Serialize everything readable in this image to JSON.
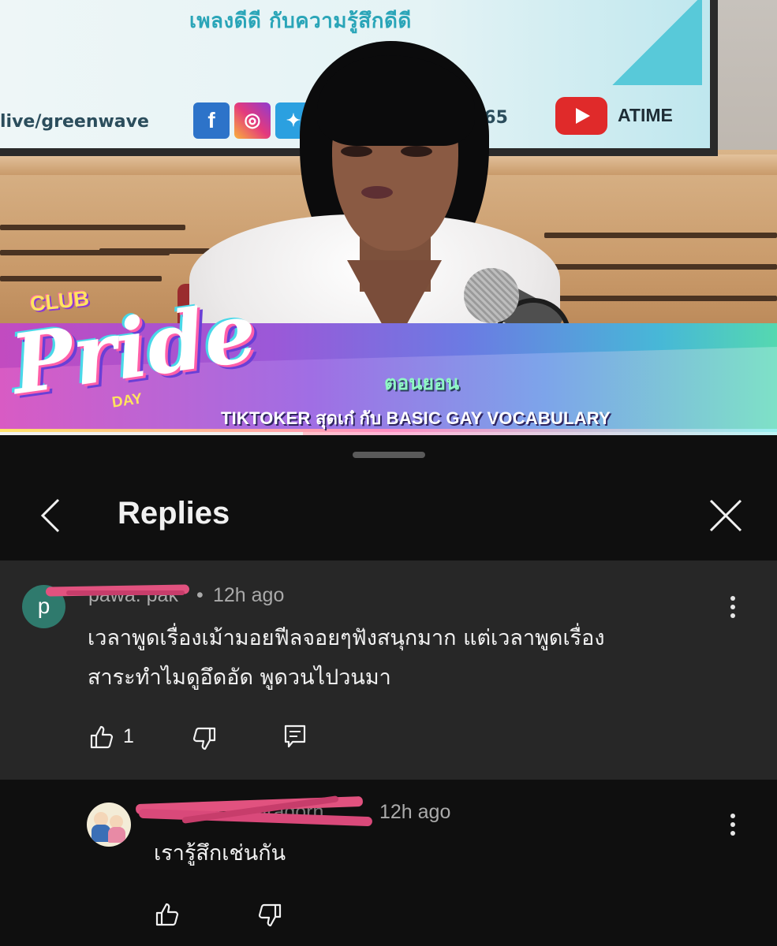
{
  "video": {
    "screen_tagline": "เพลงดีดี กับความรู้สึกดีดี",
    "screen_url": "live/greenwave",
    "screen_number": "065",
    "screen_channel": "ATIME",
    "logo_club": "CLUB",
    "logo_pride": "Pride",
    "logo_day": "DAY",
    "banner_title": "ตอนยอน",
    "banner_subtitle": "TIKTOKER สุดเก๋ กับ BASIC GAY VOCABULARY",
    "progress_fraction": 0.39
  },
  "panel": {
    "title": "Replies"
  },
  "parent_comment": {
    "avatar_letter": "p",
    "author": "pawa. pak",
    "separator": "•",
    "time": "12h ago",
    "text_line1": "เวลาพูดเรื่องเม้ามอยฟีลจอยๆฟังสนุกมาก  แต่เวลาพูดเรื่อง",
    "text_line2": "สาระทำไมดูอึดอัด พูดวนไปวนมา",
    "like_count": "1"
  },
  "reply": {
    "author": "Prakaidao Niradorn",
    "time": "12h ago",
    "text": "เรารู้สึกเช่นกัน"
  },
  "icons": {
    "back": "chevron-left-icon",
    "close": "close-icon",
    "like": "thumbs-up-icon",
    "dislike": "thumbs-down-icon",
    "reply": "comment-icon",
    "more": "more-vertical-icon"
  }
}
